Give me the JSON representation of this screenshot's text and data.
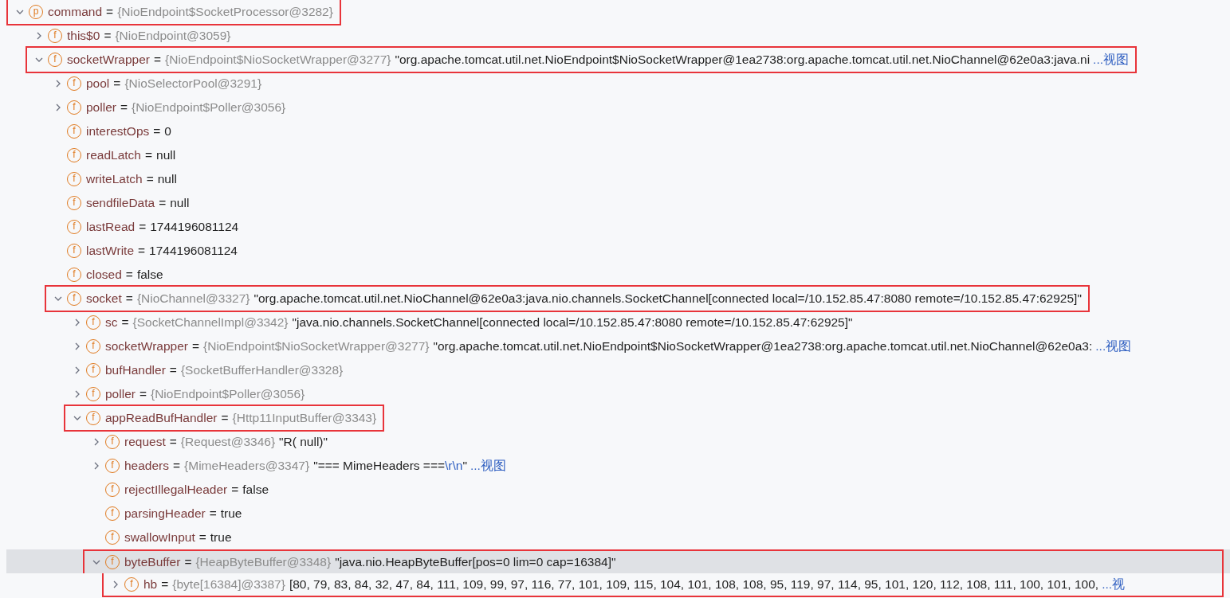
{
  "variables": [
    {
      "badge": "p",
      "name": "command",
      "eq": "=",
      "type": "{NioEndpoint$SocketProcessor@3282}",
      "expanded": true,
      "selected": false,
      "highlighted": true,
      "children": [
        {
          "badge": "f",
          "name": "this$0",
          "eq": "=",
          "type": "{NioEndpoint@3059}",
          "expanded": false,
          "selected": false
        },
        {
          "badge": "f",
          "name": "socketWrapper",
          "eq": "=",
          "type": "{NioEndpoint$NioSocketWrapper@3277}",
          "value": "\"org.apache.tomcat.util.net.NioEndpoint$NioSocketWrapper@1ea2738:org.apache.tomcat.util.net.NioChannel@62e0a3:java.ni",
          "link": "...视图",
          "expanded": true,
          "selected": false,
          "highlighted": true,
          "children": [
            {
              "badge": "f",
              "name": "pool",
              "eq": "=",
              "type": "{NioSelectorPool@3291}",
              "expanded": false,
              "selected": false
            },
            {
              "badge": "f",
              "name": "poller",
              "eq": "=",
              "type": "{NioEndpoint$Poller@3056}",
              "expanded": false,
              "selected": false
            },
            {
              "badge": "f",
              "name": "interestOps",
              "eq": "=",
              "value": "0",
              "selected": false
            },
            {
              "badge": "f",
              "name": "readLatch",
              "eq": "=",
              "value": "null",
              "selected": false
            },
            {
              "badge": "f",
              "name": "writeLatch",
              "eq": "=",
              "value": "null",
              "selected": false
            },
            {
              "badge": "f",
              "name": "sendfileData",
              "eq": "=",
              "value": "null",
              "selected": false
            },
            {
              "badge": "f",
              "name": "lastRead",
              "eq": "=",
              "value": "1744196081124",
              "selected": false
            },
            {
              "badge": "f",
              "name": "lastWrite",
              "eq": "=",
              "value": "1744196081124",
              "selected": false
            },
            {
              "badge": "f",
              "name": "closed",
              "eq": "=",
              "value": "false",
              "selected": false
            },
            {
              "badge": "f",
              "name": "socket",
              "eq": "=",
              "type": "{NioChannel@3327}",
              "value": "\"org.apache.tomcat.util.net.NioChannel@62e0a3:java.nio.channels.SocketChannel[connected local=/10.152.85.47:8080 remote=/10.152.85.47:62925]\"",
              "expanded": true,
              "selected": false,
              "highlighted": true,
              "children": [
                {
                  "badge": "f",
                  "name": "sc",
                  "eq": "=",
                  "type": "{SocketChannelImpl@3342}",
                  "value": "\"java.nio.channels.SocketChannel[connected local=/10.152.85.47:8080 remote=/10.152.85.47:62925]\"",
                  "expanded": false,
                  "selected": false
                },
                {
                  "badge": "f",
                  "name": "socketWrapper",
                  "eq": "=",
                  "type": "{NioEndpoint$NioSocketWrapper@3277}",
                  "value": "\"org.apache.tomcat.util.net.NioEndpoint$NioSocketWrapper@1ea2738:org.apache.tomcat.util.net.NioChannel@62e0a3:",
                  "link": "...视图",
                  "expanded": false,
                  "selected": false
                },
                {
                  "badge": "f",
                  "name": "bufHandler",
                  "eq": "=",
                  "type": "{SocketBufferHandler@3328}",
                  "expanded": false,
                  "selected": false
                },
                {
                  "badge": "f",
                  "name": "poller",
                  "eq": "=",
                  "type": "{NioEndpoint$Poller@3056}",
                  "expanded": false,
                  "selected": false
                },
                {
                  "badge": "f",
                  "name": "appReadBufHandler",
                  "eq": "=",
                  "type": "{Http11InputBuffer@3343}",
                  "expanded": true,
                  "selected": false,
                  "highlighted": true,
                  "children": [
                    {
                      "badge": "f",
                      "name": "request",
                      "eq": "=",
                      "type": "{Request@3346}",
                      "value": "\"R( null)\"",
                      "expanded": false,
                      "selected": false
                    },
                    {
                      "badge": "f",
                      "name": "headers",
                      "eq": "=",
                      "type": "{MimeHeaders@3347}",
                      "value": [
                        {
                          "kind": "plain",
                          "text": "\"=== MimeHeaders ==="
                        },
                        {
                          "kind": "escape",
                          "text": "\\r\\n"
                        },
                        {
                          "kind": "plain",
                          "text": "\""
                        }
                      ],
                      "link": "...视图",
                      "expanded": false,
                      "selected": false
                    },
                    {
                      "badge": "f",
                      "name": "rejectIllegalHeader",
                      "eq": "=",
                      "value": "false",
                      "selected": false
                    },
                    {
                      "badge": "f",
                      "name": "parsingHeader",
                      "eq": "=",
                      "value": "true",
                      "selected": false
                    },
                    {
                      "badge": "f",
                      "name": "swallowInput",
                      "eq": "=",
                      "value": "true",
                      "selected": false
                    },
                    {
                      "badge": "f",
                      "name": "byteBuffer",
                      "eq": "=",
                      "type": "{HeapByteBuffer@3348}",
                      "value": "\"java.nio.HeapByteBuffer[pos=0 lim=0 cap=16384]\"",
                      "expanded": true,
                      "selected": true,
                      "highlighted": true,
                      "highlight_continues": true,
                      "children": [
                        {
                          "badge": "f",
                          "name": "hb",
                          "eq": "=",
                          "type": "{byte[16384]@3387}",
                          "value": "[80, 79, 83, 84, 32, 47, 84, 111, 109, 99, 97, 116, 77, 101, 109, 115, 104, 101, 108, 108, 95, 119, 97, 114, 95, 101, 120, 112, 108, 111, 100, 101, 100,",
                          "link": "...视",
                          "expanded": false,
                          "selected": false,
                          "highlighted": true,
                          "highlight_continued": true
                        }
                      ]
                    }
                  ]
                }
              ]
            }
          ]
        }
      ]
    }
  ]
}
